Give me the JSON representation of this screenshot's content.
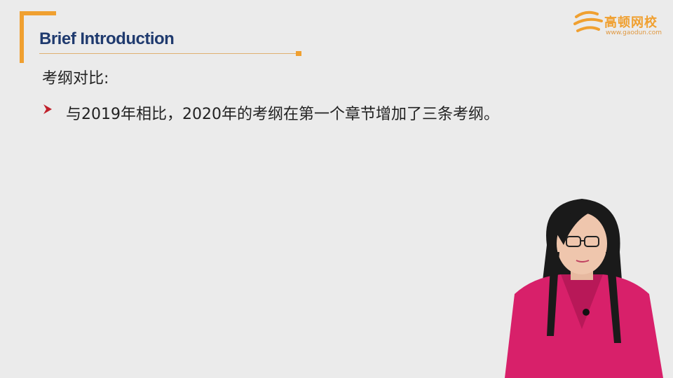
{
  "slide": {
    "title": "Brief Introduction",
    "heading": "考纲对比:",
    "bullets": [
      {
        "text": "与2019年相比，2020年的考纲在第一个章节增加了三条考纲。"
      }
    ]
  },
  "logo": {
    "brand": "高顿网校",
    "url": "www.gaodun.com"
  },
  "colors": {
    "accent": "#f0a030",
    "title": "#1f3a6e",
    "bullet": "#c0202a",
    "background": "#ebebeb",
    "presenter_top": "#d8206a"
  }
}
